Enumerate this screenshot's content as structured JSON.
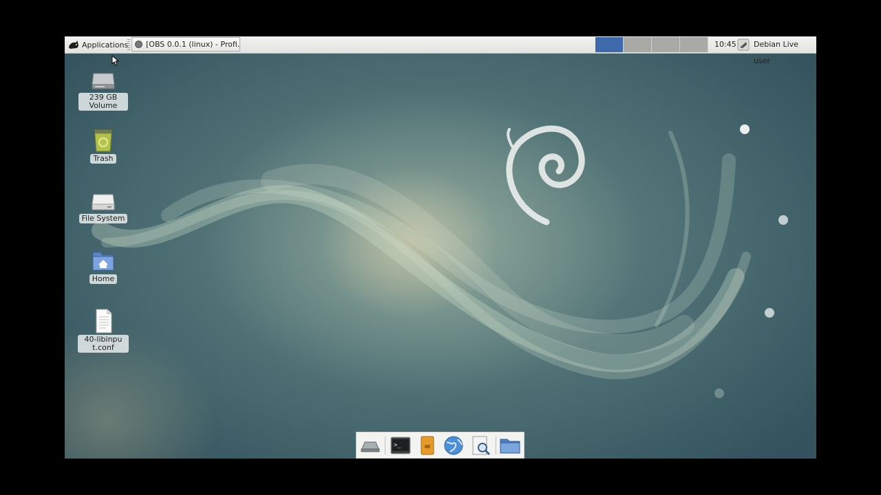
{
  "panel": {
    "applications_label": "Applications",
    "task_window_title": "[OBS 0.0.1 (linux) - Profi...",
    "workspaces": [
      {
        "name": "workspace-1",
        "active": true
      },
      {
        "name": "workspace-2",
        "active": false
      },
      {
        "name": "workspace-3",
        "active": false
      },
      {
        "name": "workspace-4",
        "active": false
      }
    ],
    "clock": "10:45",
    "user": "Debian Live user"
  },
  "desktop": {
    "icons": [
      {
        "label": "239 GB Volume",
        "icon": "drive-icon"
      },
      {
        "label": "Trash",
        "icon": "trash-icon"
      },
      {
        "label": "File System",
        "icon": "filesystem-icon"
      },
      {
        "label": "Home",
        "icon": "home-folder-icon"
      },
      {
        "label": "40-libinput.conf",
        "icon": "text-file-icon"
      }
    ]
  },
  "dock": {
    "items": [
      "show-desktop-icon",
      "terminal-icon",
      "file-manager-icon",
      "web-browser-icon",
      "app-finder-icon",
      "folder-icon"
    ]
  },
  "colors": {
    "panel_bg": "#ebebe8",
    "workspace_active": "#3e6aab",
    "workspace_inactive": "#a9a9a6",
    "wallpaper_base": "#4c6e73"
  }
}
